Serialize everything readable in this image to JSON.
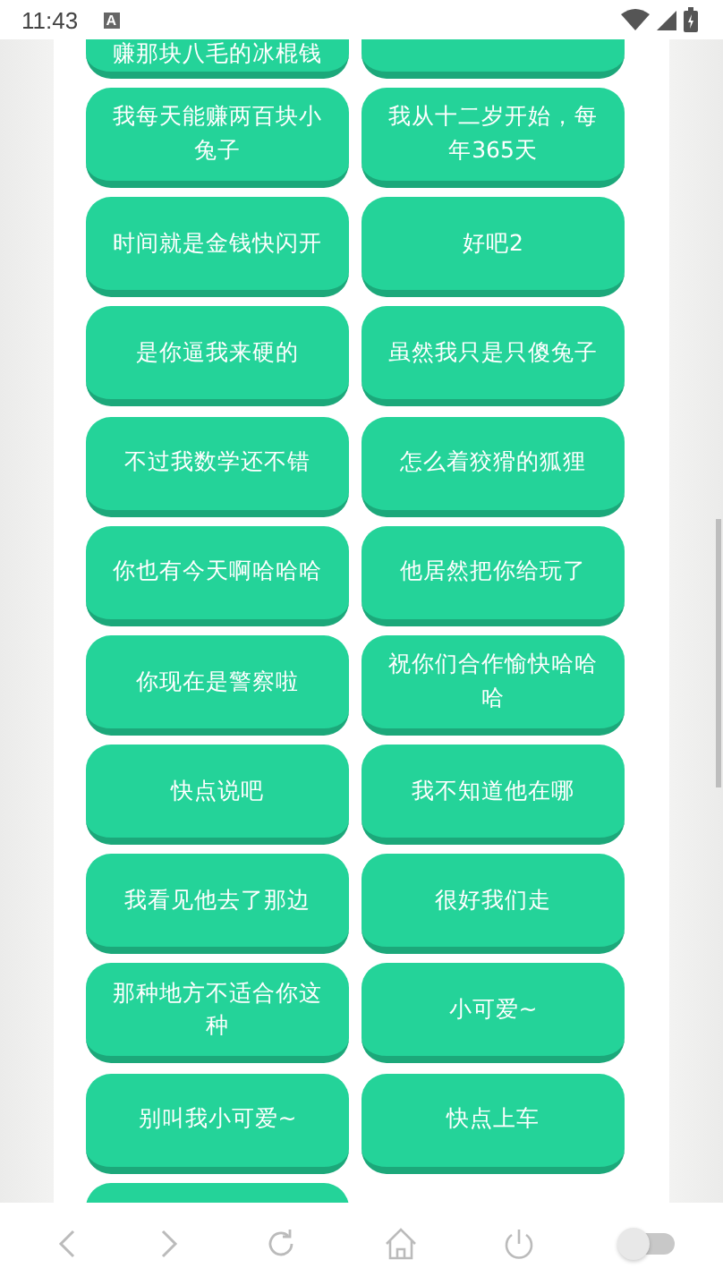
{
  "status_bar": {
    "time": "11:43",
    "notification": "A"
  },
  "rows": [
    {
      "buttons": [
        {
          "label": "赚那块八毛的冰棍钱"
        }
      ]
    },
    {
      "buttons": [
        {
          "label": "我每天能赚两百块小兔子"
        },
        {
          "label": "我从十二岁开始，每年365天"
        }
      ]
    },
    {
      "buttons": [
        {
          "label": "时间就是金钱快闪开"
        },
        {
          "label": "好吧2"
        }
      ]
    },
    {
      "buttons": [
        {
          "label": "是你逼我来硬的"
        },
        {
          "label": "虽然我只是只傻兔子"
        }
      ]
    },
    {
      "buttons": [
        {
          "label": "不过我数学还不错"
        },
        {
          "label": "怎么着狡猾的狐狸"
        }
      ]
    },
    {
      "buttons": [
        {
          "label": "你也有今天啊哈哈哈"
        },
        {
          "label": "他居然把你给玩了"
        }
      ]
    },
    {
      "buttons": [
        {
          "label": "你现在是警察啦"
        },
        {
          "label": "祝你们合作愉快哈哈哈"
        }
      ]
    },
    {
      "buttons": [
        {
          "label": "快点说吧"
        },
        {
          "label": "我不知道他在哪"
        }
      ]
    },
    {
      "buttons": [
        {
          "label": "我看见他去了那边"
        },
        {
          "label": "很好我们走"
        }
      ]
    },
    {
      "buttons": [
        {
          "label": "那种地方不适合你这种"
        },
        {
          "label": "小可爱~"
        }
      ]
    },
    {
      "buttons": [
        {
          "label": "别叫我小可爱~"
        },
        {
          "label": "快点上车"
        }
      ]
    }
  ],
  "nav_bar": {
    "toggle_on": false
  }
}
